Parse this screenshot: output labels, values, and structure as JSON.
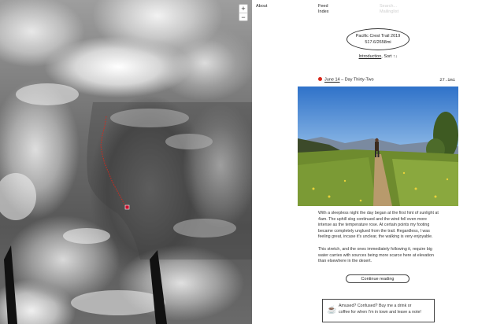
{
  "map": {
    "zoom_in_label": "+",
    "zoom_out_label": "−",
    "trail_color": "#d8281b",
    "marker_color": "#c8102e"
  },
  "nav": {
    "about": "About",
    "feed": "Feed",
    "index": "Index",
    "search_placeholder": "Search...",
    "search_sub": "Mailinglist"
  },
  "header": {
    "title": "Pacific Crest Trail 2019",
    "progress": "517.6/2658mi",
    "intro_label": "Introduction",
    "sort_label": "Sort ↑↓"
  },
  "entry": {
    "date": "June 14",
    "title": "Day Thirty-Two",
    "miles": "27.1mi",
    "paragraph1": "With a sleepless night the day began at the first hint of sunlight at 4am. The uphill slog continued and the wind fell even more intense as the temperature rose. At certain points my footing became completely unglued from the trail. Regardless, I was feeling great, incase it's unclear, the walking is very enjoyable.",
    "paragraph2": "This stretch, and the ones immediately following it, require big water carries with sources being more scarce here at elevation than elsewhere in the desert.",
    "continue_label": "Continue reading"
  },
  "coffee": {
    "icon": "coffee-cup-icon",
    "line1": "Amused? Confused? Buy me a drink or",
    "line2": "coffee for when I'm in town and leave a note!"
  },
  "colors": {
    "accent_dot": "#d8281b"
  }
}
